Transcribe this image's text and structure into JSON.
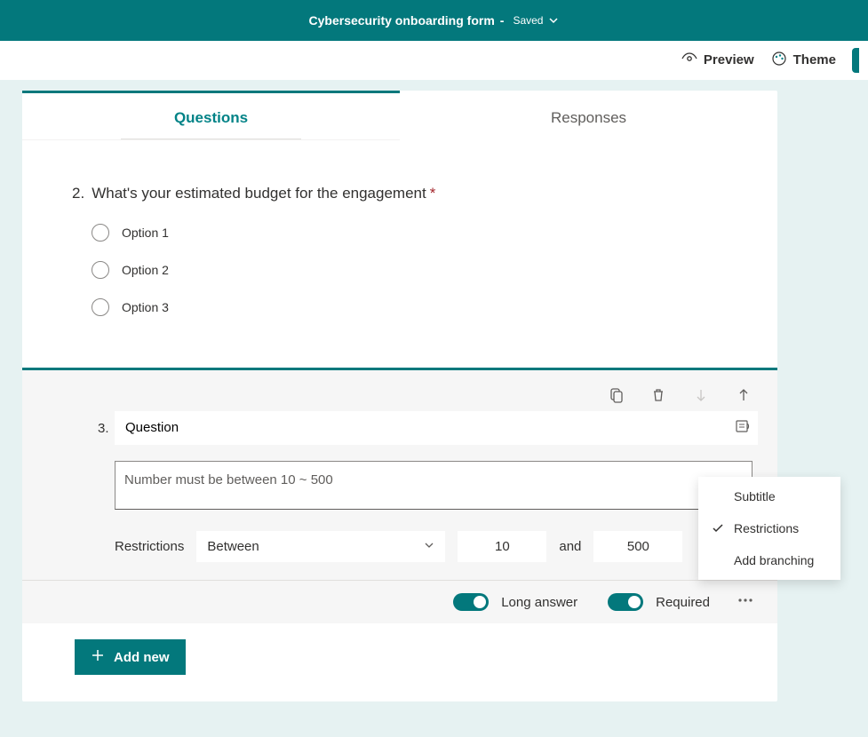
{
  "title": "Cybersecurity onboarding form",
  "saveState": "Saved",
  "toolbar": {
    "preview": "Preview",
    "theme": "Theme"
  },
  "tabs": {
    "questions": "Questions",
    "responses": "Responses"
  },
  "q2": {
    "number": "2.",
    "text": "What's your estimated budget for the engagement",
    "options": [
      "Option 1",
      "Option 2",
      "Option 3"
    ]
  },
  "q3": {
    "number": "3.",
    "title": "Question",
    "hint": "Number must be between 10 ~ 500",
    "restrictLabel": "Restrictions",
    "restrictType": "Between",
    "min": "10",
    "andLabel": "and",
    "max": "500",
    "longAnswer": "Long answer",
    "required": "Required"
  },
  "popup": {
    "subtitle": "Subtitle",
    "restrictions": "Restrictions",
    "branching": "Add branching"
  },
  "addNew": "Add new"
}
